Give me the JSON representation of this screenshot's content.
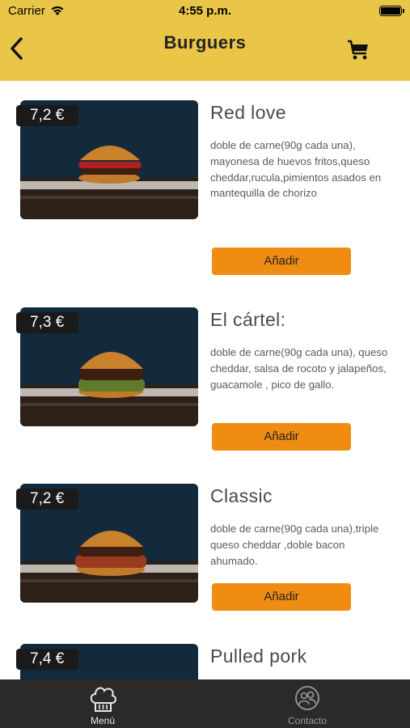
{
  "status_bar": {
    "carrier": "Carrier",
    "time": "4:55 p.m."
  },
  "header": {
    "title": "Burguers"
  },
  "products": [
    {
      "price": "7,2 €",
      "name": "Red love",
      "description": "doble de carne(90g cada una), mayonesa de huevos fritos,queso cheddar,rucula,pimientos asados en mantequilla de chorizo",
      "add_label": "Añadir",
      "sauce_color": "#b02020"
    },
    {
      "price": "7,3 €",
      "name": "El cártel:",
      "description": "doble de carne(90g cada una), queso cheddar, salsa de rocoto y jalapeños, guacamole , pico de gallo.",
      "add_label": "Añadir",
      "sauce_color": "#5f7a2a"
    },
    {
      "price": "7,2 €",
      "name": "Classic",
      "description": "doble de carne(90g cada una),triple queso cheddar ,doble bacon ahumado.",
      "add_label": "Añadir",
      "sauce_color": "#9a3a20"
    },
    {
      "price": "7,4 €",
      "name": "Pulled pork",
      "description": "",
      "add_label": "",
      "sauce_color": "#8a4a20"
    }
  ],
  "tabbar": {
    "tabs": [
      {
        "label": "Menú",
        "icon": "chef-hat-icon",
        "active": true
      },
      {
        "label": "Contacto",
        "icon": "contact-people-icon",
        "active": false
      }
    ]
  },
  "colors": {
    "header": "#e9c647",
    "add_button": "#f08c12",
    "price_tag": "#1a1a1a",
    "tabbar": "#2b2a28",
    "tab_active": "#e8e8e8",
    "tab_inactive": "#9a9a9a"
  }
}
